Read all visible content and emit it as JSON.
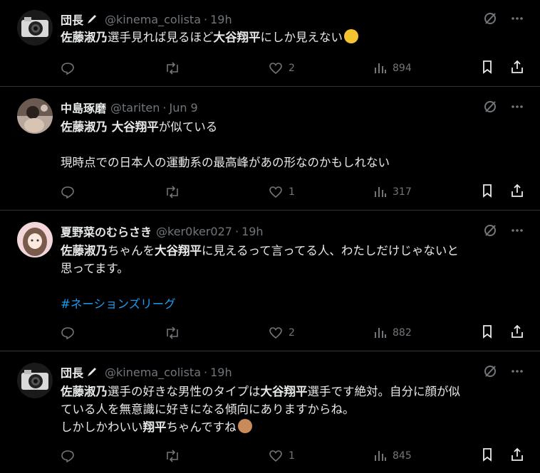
{
  "tweets": [
    {
      "name": "団長",
      "handle": "@kinema_colista",
      "sep": "·",
      "time": "19h",
      "lines": [
        [
          {
            "t": "佐藤淑乃",
            "b": true
          },
          {
            "t": "選手見れば見るほど",
            "b": false
          },
          {
            "t": "大谷翔平",
            "b": true
          },
          {
            "t": "にしか見えない",
            "b": false
          }
        ]
      ],
      "emoji": "rofl-emoji",
      "counts": {
        "replies": "",
        "retweets": "",
        "likes": "2",
        "views": "894"
      }
    },
    {
      "name": "中島琢磨",
      "handle": "@tariten",
      "sep": "·",
      "time": "Jun 9",
      "lines": [
        [
          {
            "t": "佐藤淑乃 大谷翔平",
            "b": true
          },
          {
            "t": "が似ている",
            "b": false
          }
        ],
        [],
        [
          {
            "t": "現時点での日本人の運動系の最高峰があの形なのかもしれない",
            "b": false
          }
        ]
      ],
      "counts": {
        "replies": "",
        "retweets": "",
        "likes": "1",
        "views": "317"
      }
    },
    {
      "name": "夏野菜のむらさき",
      "handle": "@ker0ker027",
      "sep": "·",
      "time": "19h",
      "lines": [
        [
          {
            "t": "佐藤淑乃",
            "b": true
          },
          {
            "t": "ちゃんを",
            "b": false
          },
          {
            "t": "大谷翔平",
            "b": true
          },
          {
            "t": "に見えるって言ってる人、わたしだけじゃないと",
            "b": false
          }
        ],
        [
          {
            "t": "思ってます。",
            "b": false
          }
        ],
        [],
        [
          {
            "t": "#ネーションズリーグ",
            "b": false,
            "tag": true
          }
        ]
      ],
      "counts": {
        "replies": "",
        "retweets": "",
        "likes": "2",
        "views": "882"
      }
    },
    {
      "name": "団長",
      "handle": "@kinema_colista",
      "sep": "·",
      "time": "19h",
      "lines": [
        [
          {
            "t": "佐藤淑乃",
            "b": true
          },
          {
            "t": "選手の好きな男性のタイプは",
            "b": false
          },
          {
            "t": "大谷翔平",
            "b": true
          },
          {
            "t": "選手です絶対。自分に顔が似",
            "b": false
          }
        ],
        [
          {
            "t": "ている人を無意識に好きになる傾向にありますからね。",
            "b": false
          }
        ],
        [
          {
            "t": "しかしかわいい",
            "b": false
          },
          {
            "t": "翔平",
            "b": true
          },
          {
            "t": "ちゃんですね",
            "b": false
          }
        ]
      ],
      "emoji": "see-no-evil-monkey-emoji",
      "counts": {
        "replies": "",
        "retweets": "",
        "likes": "1",
        "views": "845"
      }
    }
  ],
  "colors": {
    "background": "#000000",
    "text": "#e7e9ea",
    "muted": "#71767b",
    "link": "#1d9bf0",
    "border": "#2f3336"
  }
}
